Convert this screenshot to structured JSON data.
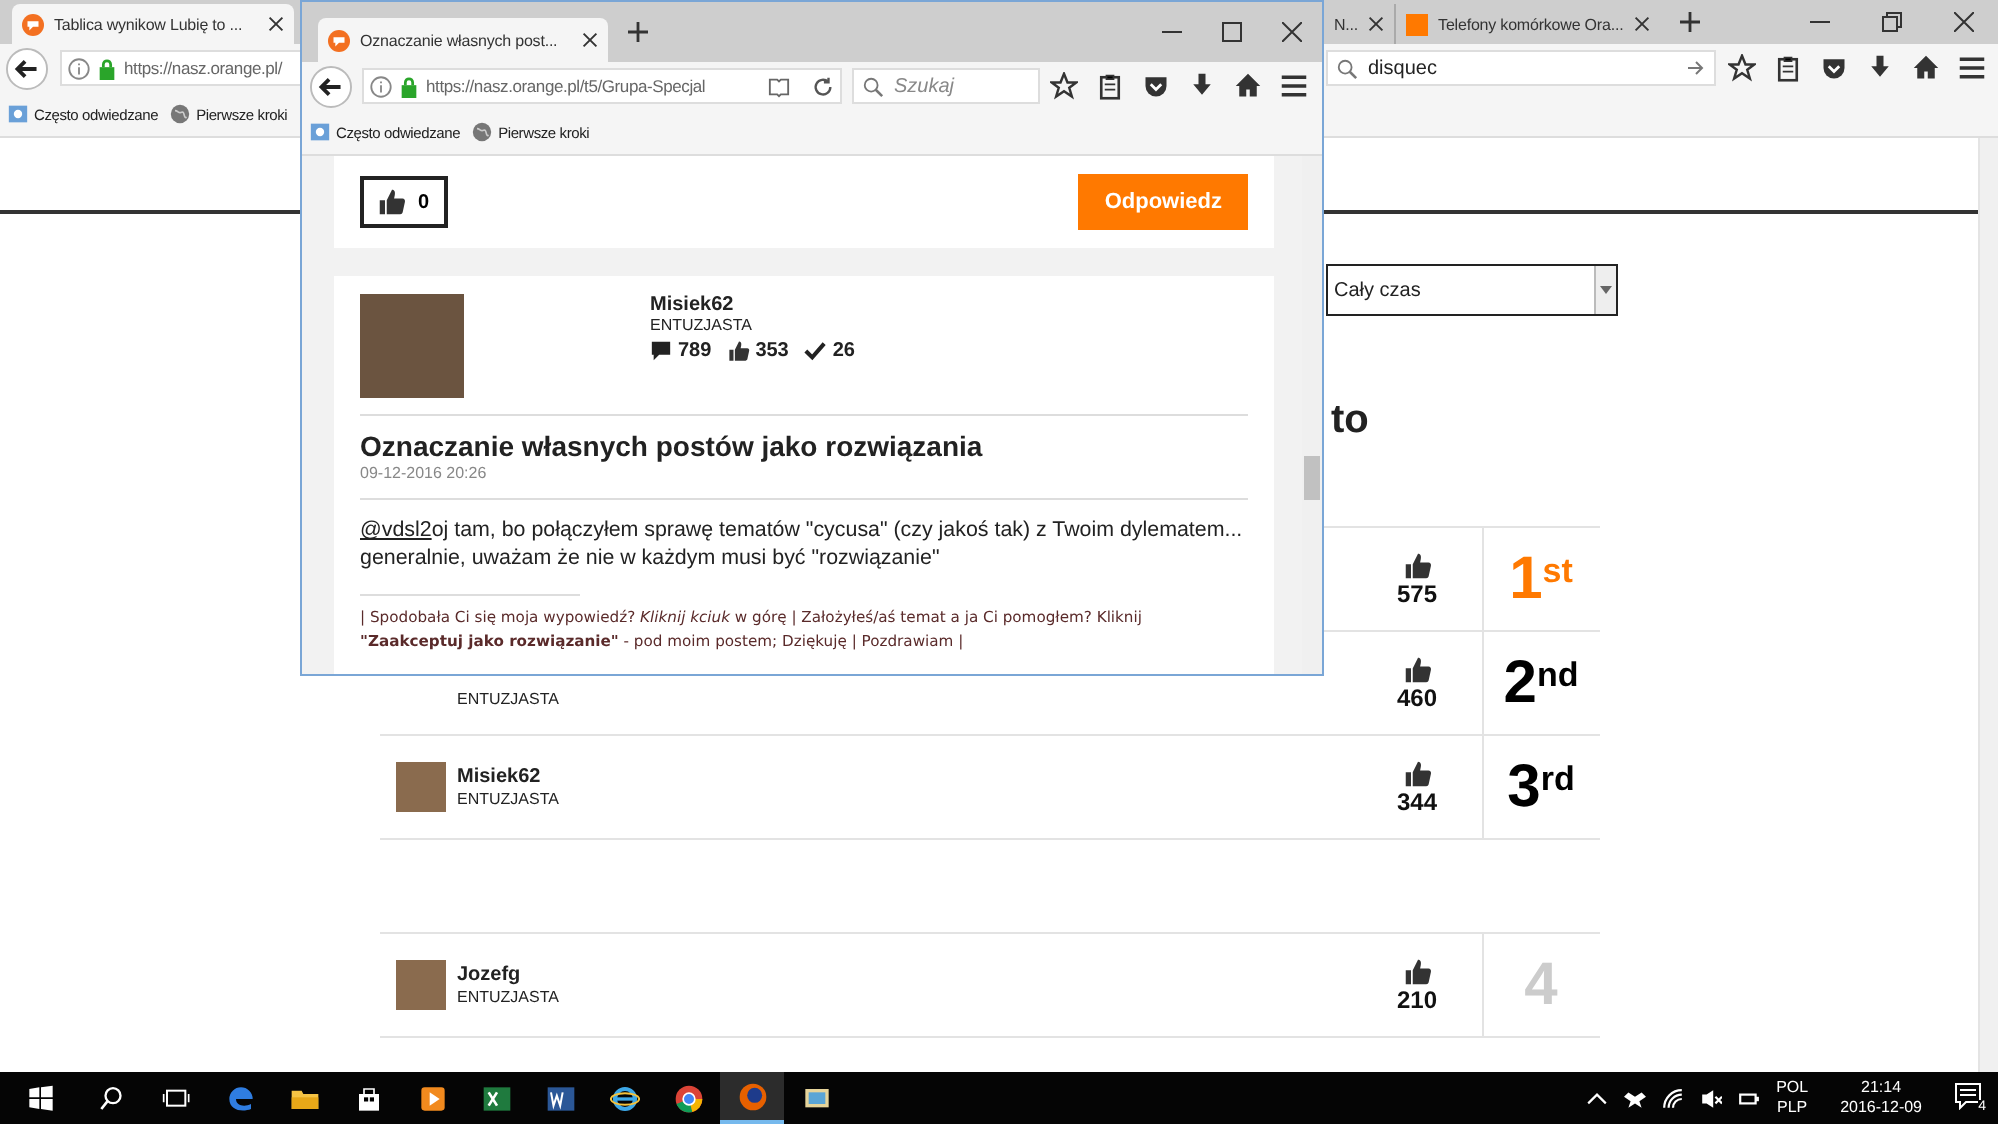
{
  "background_window": {
    "tabs": [
      {
        "label": "Tablica wynikow Lubię to ...",
        "selected": true
      },
      {
        "label": "N...",
        "selected": false
      },
      {
        "label": "Telefony komórkowe Ora...",
        "selected": false
      }
    ],
    "address": "https://nasz.orange.pl/",
    "search": {
      "value": "disquec"
    },
    "bookmarks": [
      "Często odwiedzane",
      "Pierwsze kroki"
    ],
    "period_select": {
      "value": "Cały czas"
    },
    "heading": "to",
    "leaderboard": [
      {
        "likes": "575",
        "rank": "1",
        "rank_suffix": "st",
        "color": "#ff7900"
      },
      {
        "role": "ENTUZJASTA",
        "likes": "460",
        "rank": "2",
        "rank_suffix": "nd",
        "color": "#000000"
      },
      {
        "name": "Misiek62",
        "role": "ENTUZJASTA",
        "likes": "344",
        "rank": "3",
        "rank_suffix": "rd",
        "color": "#000000"
      }
    ],
    "leaderboard_more": [
      {
        "name": "Jozefg",
        "role": "ENTUZJASTA",
        "likes": "210",
        "rank": "4",
        "color": "#cccccc"
      }
    ]
  },
  "popup_window": {
    "tabs": [
      {
        "label": "Oznaczanie własnych post...",
        "selected": true
      }
    ],
    "address": "https://nasz.orange.pl/t5/Grupa-Specjal",
    "search": {
      "placeholder": "Szukaj"
    },
    "bookmarks": [
      "Często odwiedzane",
      "Pierwsze kroki"
    ],
    "kudos_count": "0",
    "reply_button": "Odpowiedz",
    "post": {
      "author": "Misiek62",
      "role": "ENTUZJASTA",
      "stats": [
        {
          "kind": "messages",
          "value": "789"
        },
        {
          "kind": "kudos",
          "value": "353"
        },
        {
          "kind": "solutions",
          "value": "26"
        }
      ],
      "title": "Oznaczanie własnych postów jako rozwiązania",
      "date": "09-12-2016 20:26",
      "mention": "@vdsl2",
      "body": "oj tam, bo połączyłem sprawę tematów \"cycusa\" (czy jakoś tak) z Twoim dylematem... generalnie, uważam że nie w każdym musi być \"rozwiązanie\"",
      "signature": "| Spodobała Ci się moja wypowiedź? *Kliknij kciuk* w górę | Założyłeś/aś temat a ja Ci pomogłem? Kliknij **\"Zaakceptuj jako rozwiązanie\"** - pod moim postem; Dziękuję | Pozdrawiam |"
    }
  },
  "taskbar": {
    "apps": [
      {
        "kind": "start",
        "active": false
      },
      {
        "kind": "search",
        "active": false
      },
      {
        "kind": "taskview",
        "active": false
      },
      {
        "kind": "edge",
        "active": false
      },
      {
        "kind": "explorer",
        "active": false
      },
      {
        "kind": "store",
        "active": false
      },
      {
        "kind": "media",
        "active": false
      },
      {
        "kind": "excel",
        "active": false
      },
      {
        "kind": "word",
        "active": false
      },
      {
        "kind": "ie",
        "active": false
      },
      {
        "kind": "chrome",
        "active": false
      },
      {
        "kind": "firefox",
        "active": true
      },
      {
        "kind": "photos",
        "active": false
      }
    ],
    "language": [
      "POL",
      "PLP"
    ],
    "time": "21:14",
    "date": "2016-12-09",
    "notifications": "4"
  }
}
